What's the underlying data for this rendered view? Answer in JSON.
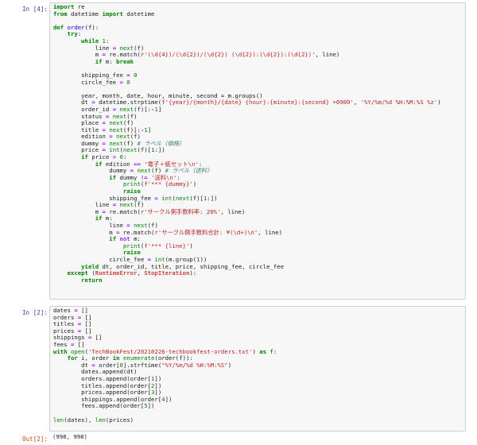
{
  "cells": [
    {
      "prompt": "In [4]:",
      "lines": [
        "import re",
        "from datetime import datetime",
        "",
        "def order(f):",
        "    try:",
        "        while 1:",
        "            line = next(f)",
        "            m = re.match(r'(\\d{4})/(\\d{2})/(\\d{2}) (\\d{2}):(\\d{2}):(\\d{2})', line)",
        "            if m: break",
        "",
        "        shipping_fee = 0",
        "        circle_fee = 0",
        "",
        "        year, month, date, hour, minute, second = m.groups()",
        "        dt = datetime.strptime(f'{year}/{month}/{date} {hour}:{minute}:{second} +0900', '%Y/%m/%d %H:%M:%S %z')",
        "        order_id = next(f)[:-1]",
        "        status = next(f)",
        "        place = next(f)",
        "        title = next(f)[:-1]",
        "        edition = next(f)",
        "        dummy = next(f) # ラベル（価格）",
        "        price = int(next(f)[1:])",
        "        if price > 0:",
        "            if edition == '電子＋紙セット\\n':",
        "                dummy = next(f) # ラベル（送料）",
        "                if dummy != '送料\\n':",
        "                    print(f'*** {dummy}')",
        "                    raise",
        "                shipping_fee = int(next(f)[1:])",
        "            line = next(f)",
        "            m = re.match(r'サークル側手数料率: 20%', line)",
        "            if m:",
        "                line = next(f)",
        "                m = re.match(r'サークル側手数料合計: ¥(\\d+)\\n', line)",
        "                if not m:",
        "                    print(f'*** {line}')",
        "                    raise",
        "                circle_fee = int(m.group(1))",
        "        yield dt, order_id, title, price, shipping_fee, circle_fee",
        "    except (RuntimeError, StopIteration):",
        "        return"
      ]
    },
    {
      "prompt": "In [2]:",
      "lines": [
        "dates = []",
        "orders = []",
        "titles = []",
        "prices = []",
        "shippings = []",
        "fees = []",
        "with open('TechBookFest/20210226-techbookfest-orders.txt') as f:",
        "    for i, order in enumerate(order(f)):",
        "        dt = order[0].strftime(\"%Y/%m/%d %H:%M:%S\")",
        "        dates.append(dt)",
        "        orders.append(order[1])",
        "        titles.append(order[2])",
        "        prices.append(order[3])",
        "        shippings.append(order[4])",
        "        fees.append(order[5])",
        "",
        "len(dates), len(prices)"
      ]
    }
  ],
  "output": {
    "prompt": "Out[2]:",
    "text": "(998, 998)"
  }
}
